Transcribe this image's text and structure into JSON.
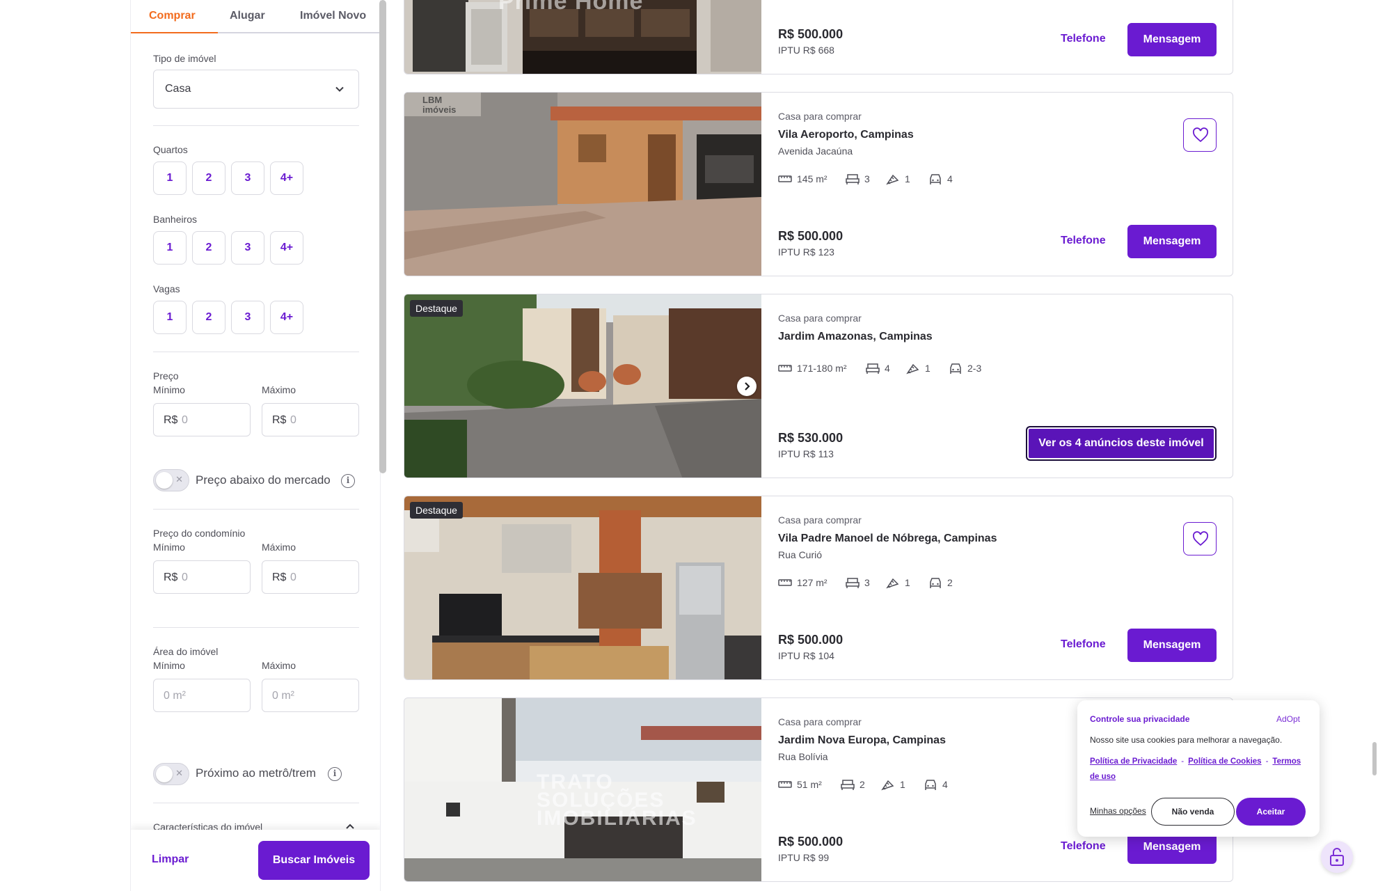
{
  "tabs": [
    {
      "label": "Comprar"
    },
    {
      "label": "Alugar"
    },
    {
      "label": "Imóvel Novo"
    }
  ],
  "filters": {
    "property_type_label": "Tipo de imóvel",
    "property_type_value": "Casa",
    "rooms_label": "Quartos",
    "baths_label": "Banheiros",
    "parking_label": "Vagas",
    "counts": [
      "1",
      "2",
      "3",
      "4+"
    ],
    "price_label": "Preço",
    "min_label": "Mínimo",
    "max_label": "Máximo",
    "currency_prefix": "R$",
    "zero_placeholder": "0",
    "below_market_label": "Preço abaixo do mercado",
    "condo_price_label": "Preço do condomínio",
    "area_label": "Área do imóvel",
    "area_placeholder": "0 m²",
    "metro_label": "Próximo ao metrô/trem",
    "features_label": "Características do imóvel",
    "clear_label": "Limpar",
    "search_label": "Buscar Imóveis"
  },
  "listings": [
    {
      "type": "",
      "title": "",
      "street": "",
      "price": "R$ 500.000",
      "iptu": "IPTU R$ 668",
      "phone_label": "Telefone",
      "message_label": "Mensagem",
      "watermark": "Prime Home"
    },
    {
      "type": "Casa para comprar",
      "title": "Vila Aeroporto, Campinas",
      "street": "Avenida Jacaúna",
      "area": "145 m²",
      "beds": "3",
      "baths": "1",
      "parking": "4",
      "price": "R$ 500.000",
      "iptu": "IPTU R$ 123",
      "phone_label": "Telefone",
      "message_label": "Mensagem",
      "watermark": "LBM imóveis"
    },
    {
      "badge": "Destaque",
      "type": "Casa para comprar",
      "title": "Jardim Amazonas, Campinas",
      "area": "171-180 m²",
      "beds": "4",
      "baths": "1",
      "parking": "2-3",
      "price": "R$ 530.000",
      "iptu": "IPTU R$ 113",
      "group_label": "Ver os 4 anúncios deste imóvel"
    },
    {
      "badge": "Destaque",
      "type": "Casa para comprar",
      "title": "Vila Padre Manoel de Nóbrega, Campinas",
      "street": "Rua Curió",
      "area": "127 m²",
      "beds": "3",
      "baths": "1",
      "parking": "2",
      "price": "R$ 500.000",
      "iptu": "IPTU R$ 104",
      "phone_label": "Telefone",
      "message_label": "Mensagem"
    },
    {
      "type": "Casa para comprar",
      "title": "Jardim Nova Europa, Campinas",
      "street": "Rua Bolívia",
      "area": "51 m²",
      "beds": "2",
      "baths": "1",
      "parking": "4",
      "price": "R$ 500.000",
      "iptu": "IPTU R$ 99",
      "phone_label": "Telefone",
      "message_label": "Mensagem",
      "watermark": "TRATO SOLUÇÕES IMOBILIÁRIAS"
    }
  ],
  "cookie": {
    "title": "Controle sua privacidade",
    "brand": "AdOpt",
    "text": "Nosso site usa cookies para melhorar a navegação.",
    "privacy_link": "Política de Privacidade",
    "cookies_link": "Política de Cookies",
    "terms_link": "Termos de uso",
    "options_label": "Minhas opções",
    "no_sell_label": "Não venda",
    "accept_label": "Aceitar"
  },
  "colors": {
    "accent": "#6a1bd1",
    "active_tab": "#f26b1d",
    "badge_bg": "#2e2e35"
  },
  "icons": [
    "chevron-down-icon",
    "info-icon",
    "ruler-icon",
    "bed-icon",
    "shower-icon",
    "car-icon",
    "heart-icon",
    "chevron-right-icon",
    "lock-icon"
  ]
}
